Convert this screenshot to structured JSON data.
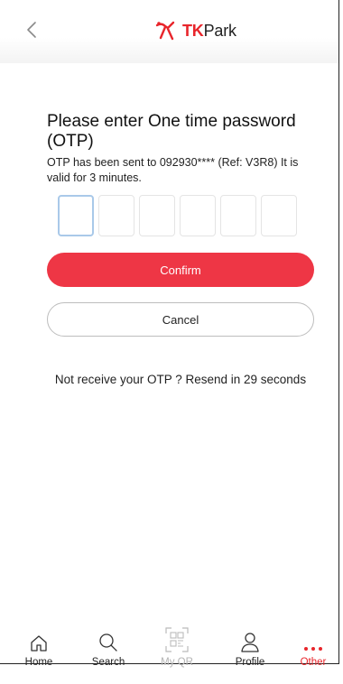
{
  "header": {
    "back_icon": "chevron-left-icon",
    "brand_logo_icon": "tkpark-logo-icon",
    "brand_tk": "TK",
    "brand_park": "Park",
    "brand_color": "#e8252b"
  },
  "otp_screen": {
    "title": "Please enter One time password (OTP)",
    "subtitle": "OTP has been sent to 092930**** (Ref: V3R8) It is valid for 3 minutes.",
    "digits": [
      "",
      "",
      "",
      "",
      "",
      ""
    ],
    "confirm_label": "Confirm",
    "cancel_label": "Cancel",
    "resend_text": "Not receive your OTP ? Resend in 29 seconds",
    "accent_color": "#ee3645"
  },
  "tabbar": {
    "items": [
      {
        "label": "Home",
        "icon": "home-icon"
      },
      {
        "label": "Search",
        "icon": "search-icon"
      },
      {
        "label": "My QR",
        "icon": "qr-code-icon"
      },
      {
        "label": "Profile",
        "icon": "profile-icon"
      },
      {
        "label": "Other",
        "icon": "more-dots-icon"
      }
    ]
  }
}
